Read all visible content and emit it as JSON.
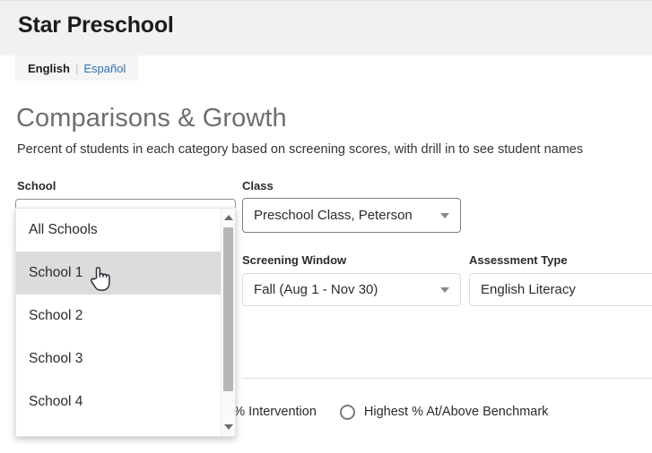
{
  "header": {
    "app_title": "Star Preschool"
  },
  "language_bar": {
    "active_label": "English",
    "separator": "|",
    "link_label": "Español"
  },
  "page": {
    "title": "Comparisons & Growth",
    "subtitle": "Percent of students in each category based on screening scores, with drill in to see student names"
  },
  "filters": {
    "school": {
      "label": "School",
      "value": "",
      "placeholder": "",
      "open": true,
      "options": [
        "All Schools",
        "School 1",
        "School 2",
        "School 3",
        "School 4"
      ],
      "highlighted_option": "School 1"
    },
    "class": {
      "label": "Class",
      "value": "Preschool Class, Peterson"
    },
    "screening_window": {
      "label": "Screening Window",
      "value": "Fall (Aug 1 - Nov 30)"
    },
    "assessment_type": {
      "label": "Assessment Type",
      "value": "English Literacy"
    }
  },
  "sort_options": {
    "items": [
      {
        "label": "Highest % Intervention",
        "selected": false
      },
      {
        "label": "Highest % At/Above Benchmark",
        "selected": false
      }
    ]
  },
  "icons": {
    "dropdown_arrow": "chevron-down-icon",
    "scroll_up": "scroll-up-arrow-icon",
    "scroll_down": "scroll-down-arrow-icon",
    "cursor": "pointer-hand-cursor-icon"
  },
  "colors": {
    "header_band": "#f1f1f1",
    "title_gray": "#6e6e6e",
    "link_blue": "#2f6fb5",
    "highlight_gray": "#dcdcdc",
    "scrollbar_thumb": "#b7b7b7"
  }
}
